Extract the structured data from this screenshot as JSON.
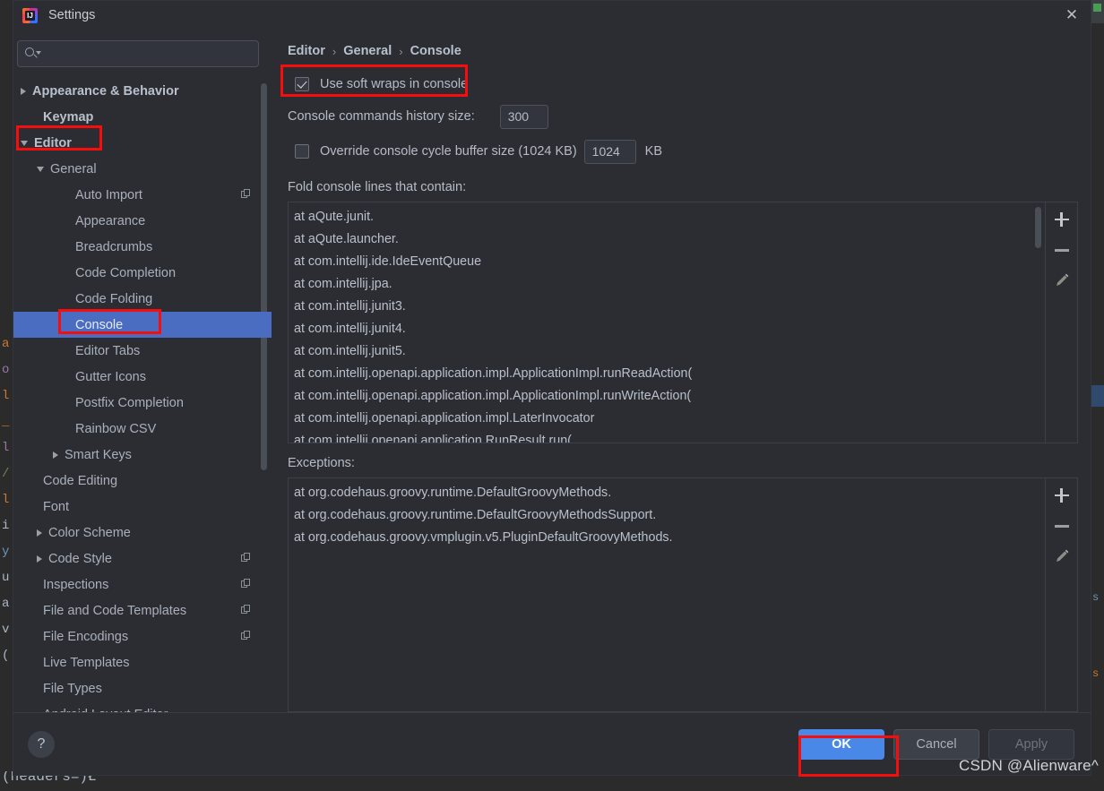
{
  "window": {
    "title": "Settings",
    "app_icon": "intellij-idea-icon",
    "close_icon": "close-icon"
  },
  "search": {
    "placeholder": "",
    "value": "",
    "icon": "search-icon"
  },
  "sidebar": {
    "items": [
      {
        "label": "Appearance & Behavior",
        "indent": 0,
        "arrow": "right",
        "bold": true,
        "selected": false,
        "copy": false
      },
      {
        "label": "Keymap",
        "indent": 1,
        "arrow": "none",
        "bold": true,
        "selected": false,
        "copy": false
      },
      {
        "label": "Editor",
        "indent": 0,
        "arrow": "down",
        "bold": true,
        "selected": false,
        "copy": false
      },
      {
        "label": "General",
        "indent": 1,
        "arrow": "down",
        "bold": false,
        "selected": false,
        "copy": false
      },
      {
        "label": "Auto Import",
        "indent": 3,
        "arrow": "none",
        "bold": false,
        "selected": false,
        "copy": true
      },
      {
        "label": "Appearance",
        "indent": 3,
        "arrow": "none",
        "bold": false,
        "selected": false,
        "copy": false
      },
      {
        "label": "Breadcrumbs",
        "indent": 3,
        "arrow": "none",
        "bold": false,
        "selected": false,
        "copy": false
      },
      {
        "label": "Code Completion",
        "indent": 3,
        "arrow": "none",
        "bold": false,
        "selected": false,
        "copy": false
      },
      {
        "label": "Code Folding",
        "indent": 3,
        "arrow": "none",
        "bold": false,
        "selected": false,
        "copy": false
      },
      {
        "label": "Console",
        "indent": 3,
        "arrow": "none",
        "bold": false,
        "selected": true,
        "copy": false
      },
      {
        "label": "Editor Tabs",
        "indent": 3,
        "arrow": "none",
        "bold": false,
        "selected": false,
        "copy": false
      },
      {
        "label": "Gutter Icons",
        "indent": 3,
        "arrow": "none",
        "bold": false,
        "selected": false,
        "copy": false
      },
      {
        "label": "Postfix Completion",
        "indent": 3,
        "arrow": "none",
        "bold": false,
        "selected": false,
        "copy": false
      },
      {
        "label": "Rainbow CSV",
        "indent": 3,
        "arrow": "none",
        "bold": false,
        "selected": false,
        "copy": false
      },
      {
        "label": "Smart Keys",
        "indent": 2,
        "arrow": "right",
        "bold": false,
        "selected": false,
        "copy": false
      },
      {
        "label": "Code Editing",
        "indent": 1,
        "arrow": "none",
        "bold": false,
        "selected": false,
        "copy": false
      },
      {
        "label": "Font",
        "indent": 1,
        "arrow": "none",
        "bold": false,
        "selected": false,
        "copy": false
      },
      {
        "label": "Color Scheme",
        "indent": 1,
        "arrow": "right",
        "bold": false,
        "selected": false,
        "copy": false
      },
      {
        "label": "Code Style",
        "indent": 1,
        "arrow": "right",
        "bold": false,
        "selected": false,
        "copy": true
      },
      {
        "label": "Inspections",
        "indent": 1,
        "arrow": "none",
        "bold": false,
        "selected": false,
        "copy": true
      },
      {
        "label": "File and Code Templates",
        "indent": 1,
        "arrow": "none",
        "bold": false,
        "selected": false,
        "copy": true
      },
      {
        "label": "File Encodings",
        "indent": 1,
        "arrow": "none",
        "bold": false,
        "selected": false,
        "copy": true
      },
      {
        "label": "Live Templates",
        "indent": 1,
        "arrow": "none",
        "bold": false,
        "selected": false,
        "copy": false
      },
      {
        "label": "File Types",
        "indent": 1,
        "arrow": "none",
        "bold": false,
        "selected": false,
        "copy": false
      },
      {
        "label": "Android Layout Editor",
        "indent": 1,
        "arrow": "none",
        "bold": false,
        "selected": false,
        "copy": false
      }
    ]
  },
  "breadcrumb": {
    "parts": [
      "Editor",
      "General",
      "Console"
    ],
    "separator": "›"
  },
  "settings": {
    "soft_wraps": {
      "label": "Use soft wraps in console",
      "checked": true
    },
    "history": {
      "label": "Console commands history size:",
      "value": "300"
    },
    "override_buffer": {
      "label": "Override console cycle buffer size (1024 KB)",
      "checked": false,
      "value": "1024",
      "unit": "KB"
    },
    "fold_label": "Fold console lines that contain:",
    "fold_items": [
      "at aQute.junit.",
      "at aQute.launcher.",
      "at com.intellij.ide.IdeEventQueue",
      "at com.intellij.jpa.",
      "at com.intellij.junit3.",
      "at com.intellij.junit4.",
      "at com.intellij.junit5.",
      "at com.intellij.openapi.application.impl.ApplicationImpl.runReadAction(",
      "at com.intellij.openapi.application.impl.ApplicationImpl.runWriteAction(",
      "at com.intellij.openapi.application.impl.LaterInvocator",
      "at com.intellij.openapi.application.RunResult.run("
    ],
    "exceptions_label": "Exceptions:",
    "exception_items": [
      "at org.codehaus.groovy.runtime.DefaultGroovyMethods.",
      "at org.codehaus.groovy.runtime.DefaultGroovyMethodsSupport.",
      "at org.codehaus.groovy.vmplugin.v5.PluginDefaultGroovyMethods."
    ],
    "list_buttons": [
      {
        "icon": "plus-icon",
        "name": "add"
      },
      {
        "icon": "minus-icon",
        "name": "remove"
      },
      {
        "icon": "pencil-icon",
        "name": "edit"
      }
    ]
  },
  "footer": {
    "help_icon": "question-mark-icon",
    "ok": "OK",
    "cancel": "Cancel",
    "apply": "Apply"
  },
  "watermark": "CSDN @Alienware^",
  "background": {
    "left_chars": [
      "a",
      "o",
      "l",
      "_",
      "l",
      "/",
      "l",
      "i",
      "y",
      "u",
      "a",
      "v",
      "("
    ],
    "bottom_text": "(headers=)Ł"
  },
  "colors": {
    "accent_blue": "#4a88e8",
    "selection_blue": "#4a6cc1",
    "annotation_red": "#f60d0d",
    "dialog_bg": "#2b2d33",
    "text": "#b6bcc6"
  }
}
